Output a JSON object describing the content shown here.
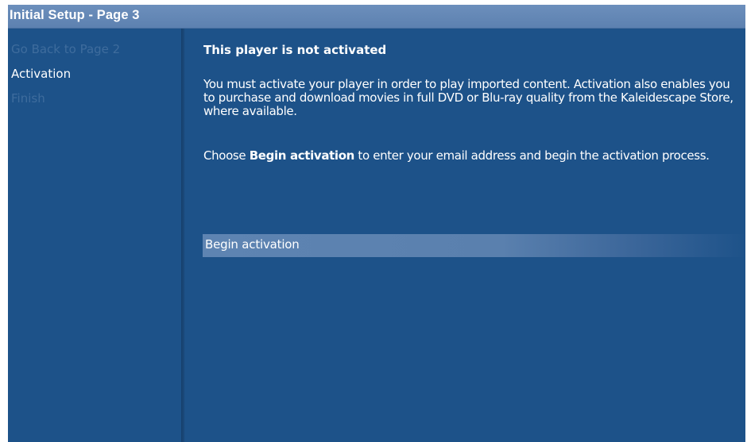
{
  "window": {
    "title": "Initial Setup - Page 3"
  },
  "sidebar": {
    "items": [
      {
        "label": "Go Back to Page 2",
        "state": "dimmed"
      },
      {
        "label": "Activation",
        "state": "current"
      },
      {
        "label": "Finish",
        "state": "dimmed"
      }
    ]
  },
  "main": {
    "heading": "This player is not activated",
    "paragraph1": "You must activate your player in order to play imported content.  Activation also enables you to purchase and download movies in full DVD or Blu-ray quality from the Kaleidescape Store, where available.",
    "paragraph2_prefix": "Choose ",
    "paragraph2_bold": "Begin activation",
    "paragraph2_suffix": " to enter your email address and begin the activation process.",
    "action_label": "Begin activation"
  },
  "colors": {
    "background": "#1d5289",
    "titlebar": "#6585b4",
    "dim_text": "#3e6c9d",
    "text": "#ffffff",
    "highlight": "#5e84b2"
  }
}
